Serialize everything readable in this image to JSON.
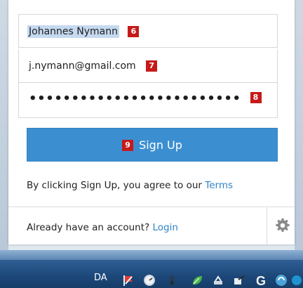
{
  "form": {
    "name_value": "Johannes Nymann",
    "name_badge": "6",
    "email_value": "j.nymann@gmail.com",
    "email_badge": "7",
    "password_value": "•••••••••••••••••••••••••",
    "password_badge": "8",
    "signup_badge": "9",
    "signup_label": "Sign Up"
  },
  "terms": {
    "prefix": "By clicking Sign Up, you agree to our ",
    "link": "Terms"
  },
  "footer": {
    "prompt": "Already have an account? ",
    "login_link": "Login"
  },
  "taskbar": {
    "language": "DA"
  },
  "colors": {
    "primary_button": "#3b8fd1",
    "link": "#2f82c8",
    "badge": "#c61a1a"
  },
  "icons": [
    "gear-icon",
    "flag-icon",
    "gauge-icon",
    "shield-icon",
    "leaf-icon",
    "network-icon",
    "share-icon",
    "g-icon",
    "globe-icon"
  ]
}
